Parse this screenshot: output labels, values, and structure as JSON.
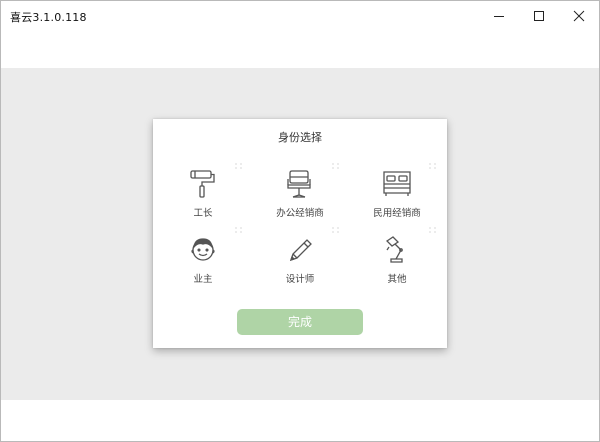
{
  "window": {
    "title": "喜云3.1.0.118"
  },
  "dialog": {
    "title": "身份选择",
    "roles": [
      {
        "label": "工长",
        "icon": "paint-roller-icon"
      },
      {
        "label": "办公经销商",
        "icon": "office-chair-icon"
      },
      {
        "label": "民用经销商",
        "icon": "bed-icon"
      },
      {
        "label": "业主",
        "icon": "owner-face-icon"
      },
      {
        "label": "设计师",
        "icon": "pencil-icon"
      },
      {
        "label": "其他",
        "icon": "desk-lamp-icon"
      }
    ],
    "finish_label": "完成"
  },
  "colors": {
    "accent_button": "#afd4a6",
    "content_background": "#ebebeb",
    "icon_stroke": "#555555"
  }
}
